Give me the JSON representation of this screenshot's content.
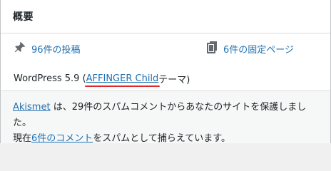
{
  "widget": {
    "title": "概要"
  },
  "glance": {
    "posts": {
      "icon": "pushpin-icon",
      "label": "96件の投稿"
    },
    "pages": {
      "icon": "pages-icon",
      "label": "6件の固定ページ"
    }
  },
  "version": {
    "prefix": "WordPress 5.9 (",
    "theme_link": "AFFINGER Child",
    "suffix": " テーマ)"
  },
  "akismet": {
    "link": "Akismet",
    "text1": " は、29件のスパムコメントからあなたのサイトを保護しました。",
    "text2_prefix": "現在",
    "comments_link": "6件のコメント",
    "text2_suffix": "をスパムとして捕らえています。"
  },
  "colors": {
    "link": "#2271b1",
    "annotation": "#e4262d"
  }
}
